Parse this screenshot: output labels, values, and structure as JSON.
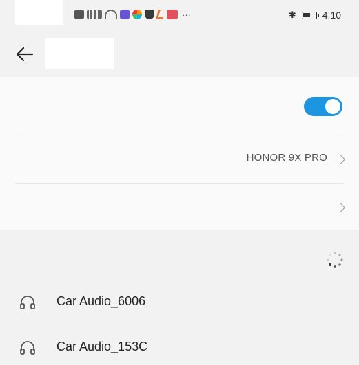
{
  "status_bar": {
    "time": "4:10",
    "overflow": "···",
    "icons": [
      "hd-icon",
      "signal-icon",
      "wifi-icon",
      "app-purple-icon",
      "app-multicolor-icon",
      "shield-icon",
      "app-orange-icon",
      "app-red-icon"
    ],
    "bluetooth_glyph": "✱"
  },
  "header": {
    "back_icon": "back-arrow-icon"
  },
  "settings": {
    "toggle_on": true,
    "accent_color": "#1d96e2",
    "device_name_value": "HONOR 9X PRO"
  },
  "available_devices": {
    "searching": true,
    "items": [
      {
        "name": "Car Audio_6006",
        "icon": "headset-icon"
      },
      {
        "name": "Car Audio_153C",
        "icon": "headset-icon"
      }
    ]
  }
}
